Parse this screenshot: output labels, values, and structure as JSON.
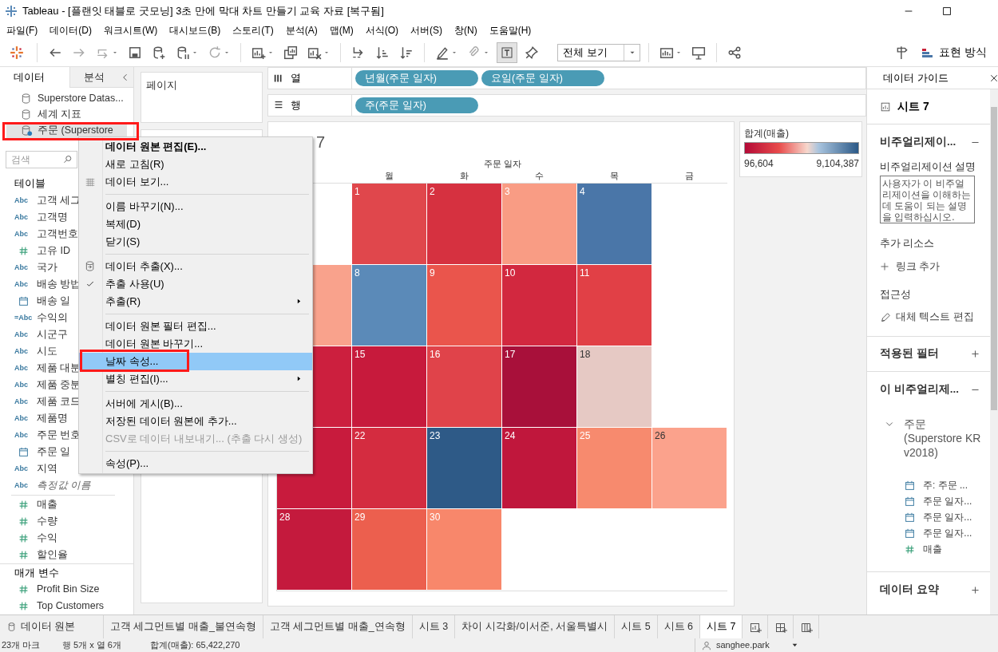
{
  "window": {
    "title": "Tableau - [플랜잇 태블로 굿모닝] 3초 만에 막대 차트 만들기 교육 자료 [복구됨]"
  },
  "menu_bar": [
    "파일(F)",
    "데이터(D)",
    "워크시트(W)",
    "대시보드(B)",
    "스토리(T)",
    "분석(A)",
    "맵(M)",
    "서식(O)",
    "서버(S)",
    "창(N)",
    "도움말(H)"
  ],
  "toolbar": {
    "view_select": "전체 보기",
    "show_me": "표현 방식"
  },
  "left_panel": {
    "tabs": [
      {
        "label": "데이터",
        "selected": true
      },
      {
        "label": "분석",
        "selected": false
      }
    ],
    "data_sources": [
      {
        "label": "Superstore Datas...",
        "selected": false
      },
      {
        "label": "세계 지표",
        "selected": false
      },
      {
        "label": "주문 (Superstore",
        "selected": true
      }
    ],
    "search": {
      "placeholder": "검색"
    },
    "tables_heading": "테이블",
    "fields": [
      {
        "kind": "string",
        "badge": "Abc",
        "label": "고객 세그"
      },
      {
        "kind": "string",
        "badge": "Abc",
        "label": "고객명"
      },
      {
        "kind": "string",
        "badge": "Abc",
        "label": "고객번호"
      },
      {
        "kind": "number",
        "label": "고유 ID"
      },
      {
        "kind": "string",
        "badge": "Abc",
        "label": "국가"
      },
      {
        "kind": "string",
        "badge": "Abc",
        "label": "배송 방법"
      },
      {
        "kind": "date",
        "label": "배송 일"
      },
      {
        "kind": "string",
        "badge": "=Abc",
        "label": "수익의"
      },
      {
        "kind": "string",
        "badge": "Abc",
        "label": "시군구"
      },
      {
        "kind": "string",
        "badge": "Abc",
        "label": "시도"
      },
      {
        "kind": "string",
        "badge": "Abc",
        "label": "제품 대분"
      },
      {
        "kind": "string",
        "badge": "Abc",
        "label": "제품 중분"
      },
      {
        "kind": "string",
        "badge": "Abc",
        "label": "제품 코드"
      },
      {
        "kind": "string",
        "badge": "Abc",
        "label": "제품명"
      },
      {
        "kind": "string",
        "badge": "Abc",
        "label": "주문 번호"
      },
      {
        "kind": "date",
        "label": "주문 일"
      },
      {
        "kind": "string",
        "badge": "Abc",
        "label": "지역"
      },
      {
        "kind": "generated",
        "badge": "Abc",
        "label": "측정값 이름"
      }
    ],
    "measures": [
      {
        "kind": "number",
        "label": "매출"
      },
      {
        "kind": "number",
        "label": "수량"
      },
      {
        "kind": "number",
        "label": "수익"
      },
      {
        "kind": "number",
        "label": "할인율"
      }
    ],
    "parameters_heading": "매개 변수",
    "parameters": [
      {
        "kind": "number",
        "label": "Profit Bin Size"
      },
      {
        "kind": "number",
        "label": "Top Customers"
      }
    ]
  },
  "shelves": {
    "pages": "페이지",
    "columns": {
      "label": "열",
      "pills": [
        "년월(주문 일자)",
        "요일(주문 일자)"
      ]
    },
    "rows": {
      "label": "행",
      "pills": [
        "주(주문 일자)"
      ]
    }
  },
  "view": {
    "title_fragment": "7",
    "header": "주문 일자",
    "weekdays": [
      "월",
      "화",
      "수",
      "목",
      "금"
    ],
    "cells": [
      [
        {
          "kind": "empty"
        },
        {
          "kind": "mark",
          "day": "1",
          "color": "#e0474c"
        },
        {
          "kind": "mark",
          "day": "2",
          "color": "#d63140"
        },
        {
          "kind": "mark",
          "day": "3",
          "color": "#f99c84"
        },
        {
          "kind": "mark",
          "day": "4",
          "color": "#4a76a8"
        },
        {
          "kind": "empty"
        }
      ],
      [
        {
          "kind": "mark",
          "color": "#f9a28c"
        },
        {
          "kind": "mark",
          "day": "8",
          "color": "#5b8ab8"
        },
        {
          "kind": "mark",
          "day": "9",
          "color": "#ea554c"
        },
        {
          "kind": "mark",
          "day": "10",
          "color": "#d2283f"
        },
        {
          "kind": "mark",
          "day": "11",
          "color": "#e14046"
        },
        {
          "kind": "empty"
        }
      ],
      [
        {
          "kind": "mark",
          "color": "#cc1f3e"
        },
        {
          "kind": "mark",
          "day": "15",
          "color": "#c71a3c"
        },
        {
          "kind": "mark",
          "day": "16",
          "color": "#e0434a"
        },
        {
          "kind": "mark",
          "day": "17",
          "color": "#a8103a"
        },
        {
          "kind": "mark",
          "day": "18",
          "color": "#e6c9c4"
        },
        {
          "kind": "empty"
        }
      ],
      [
        {
          "kind": "mark",
          "color": "#c81b3d"
        },
        {
          "kind": "mark",
          "day": "22",
          "color": "#d42c40"
        },
        {
          "kind": "mark",
          "day": "23",
          "color": "#2e5a87"
        },
        {
          "kind": "mark",
          "day": "24",
          "color": "#c0173c"
        },
        {
          "kind": "mark",
          "day": "25",
          "color": "#f78a6e"
        },
        {
          "kind": "mark",
          "day": "26",
          "color": "#fba28c"
        }
      ],
      [
        {
          "kind": "mark",
          "day": "28",
          "color": "#c41a3d"
        },
        {
          "kind": "mark",
          "day": "29",
          "color": "#ec5f4e"
        },
        {
          "kind": "mark",
          "day": "30",
          "color": "#f8876b"
        },
        {
          "kind": "empty"
        },
        {
          "kind": "empty"
        },
        {
          "kind": "empty"
        }
      ]
    ]
  },
  "legend": {
    "title": "합계(매출)",
    "min": "96,604",
    "max": "9,104,387"
  },
  "context_menu": [
    {
      "kind": "item",
      "label": "데이터 원본 편집(E)...",
      "default": true,
      "selected": false,
      "checked": false,
      "disabled": false,
      "submenu": false
    },
    {
      "kind": "item",
      "label": "새로 고침(R)",
      "default": false,
      "selected": false,
      "checked": false,
      "disabled": false,
      "submenu": false
    },
    {
      "kind": "item",
      "label": "데이터 보기...",
      "default": false,
      "selected": false,
      "checked": false,
      "disabled": false,
      "submenu": false
    },
    {
      "kind": "separator"
    },
    {
      "kind": "item",
      "label": "이름 바꾸기(N)...",
      "default": false,
      "selected": false,
      "checked": false,
      "disabled": false,
      "submenu": false
    },
    {
      "kind": "item",
      "label": "복제(D)",
      "default": false,
      "selected": false,
      "checked": false,
      "disabled": false,
      "submenu": false
    },
    {
      "kind": "item",
      "label": "닫기(S)",
      "default": false,
      "selected": false,
      "checked": false,
      "disabled": false,
      "submenu": false
    },
    {
      "kind": "separator"
    },
    {
      "kind": "item",
      "label": "데이터 추출(X)...",
      "default": false,
      "selected": false,
      "checked": false,
      "disabled": false,
      "submenu": false
    },
    {
      "kind": "item",
      "label": "추출 사용(U)",
      "default": false,
      "selected": false,
      "checked": true,
      "disabled": false,
      "submenu": false
    },
    {
      "kind": "item",
      "label": "추출(R)",
      "default": false,
      "selected": false,
      "checked": false,
      "disabled": false,
      "submenu": true
    },
    {
      "kind": "separator"
    },
    {
      "kind": "item",
      "label": "데이터 원본 필터 편집...",
      "default": false,
      "selected": false,
      "checked": false,
      "disabled": false,
      "submenu": false
    },
    {
      "kind": "item",
      "label": "데이터 원본 바꾸기...",
      "default": false,
      "selected": false,
      "checked": false,
      "disabled": false,
      "submenu": false
    },
    {
      "kind": "item",
      "label": "날짜 속성...",
      "default": false,
      "selected": true,
      "checked": false,
      "disabled": false,
      "submenu": false
    },
    {
      "kind": "item",
      "label": "별칭 편집(I)...",
      "default": false,
      "selected": false,
      "checked": false,
      "disabled": false,
      "submenu": true
    },
    {
      "kind": "separator"
    },
    {
      "kind": "item",
      "label": "서버에 게시(B)...",
      "default": false,
      "selected": false,
      "checked": false,
      "disabled": false,
      "submenu": false
    },
    {
      "kind": "item",
      "label": "저장된 데이터 원본에 추가...",
      "default": false,
      "selected": false,
      "checked": false,
      "disabled": false,
      "submenu": false
    },
    {
      "kind": "item",
      "label": "CSV로 데이터 내보내기... (추출 다시 생성)",
      "default": false,
      "selected": false,
      "checked": false,
      "disabled": true,
      "submenu": false
    },
    {
      "kind": "separator"
    },
    {
      "kind": "item",
      "label": "속성(P)...",
      "default": false,
      "selected": false,
      "checked": false,
      "disabled": false,
      "submenu": false
    }
  ],
  "data_guide": {
    "title": "데이터 가이드",
    "sheet": "시트 7",
    "viz_section": {
      "label": "비주얼리제이...",
      "expanded": true
    },
    "description_label": "비주얼리제이션 설명",
    "description_placeholder": "사용자가 이 비주얼리제이션을 이해하는 데 도움이 되는 설명을 입력하십시오.",
    "resources_label": "추가 리소스",
    "add_link": "링크 추가",
    "accessibility_label": "접근성",
    "edit_alt_text": "대체 텍스트 편집",
    "filters_section": {
      "label": "적용된 필터",
      "expanded": false
    },
    "fields_section": {
      "label": "이 비주얼리제...",
      "expanded": true
    },
    "source": {
      "label": "주문 (Superstore KR v2018)",
      "expanded": true,
      "fields": [
        {
          "kind": "date",
          "label": "주: 주문 ..."
        },
        {
          "kind": "date",
          "label": "주문 일자..."
        },
        {
          "kind": "date",
          "label": "주문 일자..."
        },
        {
          "kind": "date",
          "label": "주문 일자..."
        },
        {
          "kind": "number",
          "label": "매출"
        }
      ]
    },
    "summary_section": {
      "label": "데이터 요약",
      "expanded": false
    }
  },
  "sheet_tabs": [
    {
      "kind": "source",
      "label": "데이터 원본",
      "selected": false
    },
    {
      "kind": "sheet",
      "label": "고객 세그먼트별 매출_불연속형",
      "selected": false
    },
    {
      "kind": "sheet",
      "label": "고객 세그먼트별 매출_연속형",
      "selected": false
    },
    {
      "kind": "sheet",
      "label": "시트 3",
      "selected": false
    },
    {
      "kind": "sheet",
      "label": "차이 시각화/이서준, 서울특별시",
      "selected": false
    },
    {
      "kind": "sheet",
      "label": "시트 5",
      "selected": false
    },
    {
      "kind": "sheet",
      "label": "시트 6",
      "selected": false
    },
    {
      "kind": "sheet",
      "label": "시트 7",
      "selected": true
    }
  ],
  "status_bar": {
    "marks": "23개 마크",
    "dimensions": "행 5개 x 열 6개",
    "sum": "합계(매출): 65,422,270",
    "user": "sanghee.park"
  }
}
